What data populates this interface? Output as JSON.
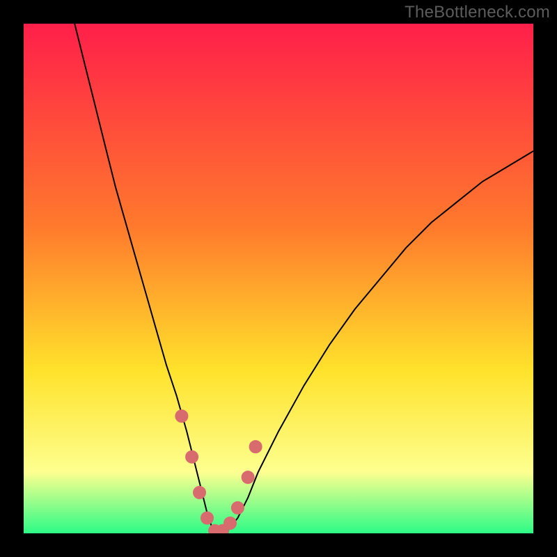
{
  "watermark": "TheBottleneck.com",
  "colors": {
    "frame": "#000000",
    "gradient_top": "#ff1f4a",
    "gradient_mid1": "#ff7a2c",
    "gradient_mid2": "#ffe22b",
    "gradient_mid3": "#fdff8f",
    "gradient_bottom": "#2cfb86",
    "marker_fill": "#d86b6e",
    "marker_stroke": "#d86b6e",
    "curve_stroke": "#000000"
  },
  "chart_data": {
    "type": "line",
    "title": "",
    "xlabel": "",
    "ylabel": "",
    "xlim": [
      0,
      100
    ],
    "ylim": [
      0,
      100
    ],
    "series": [
      {
        "name": "bottleneck-curve",
        "x": [
          10,
          12,
          14,
          16,
          18,
          20,
          22,
          24,
          26,
          28,
          30,
          32,
          34,
          35,
          36,
          37,
          38,
          39,
          40,
          42,
          44,
          46,
          50,
          55,
          60,
          65,
          70,
          75,
          80,
          85,
          90,
          95,
          100
        ],
        "y": [
          100,
          92,
          84,
          76,
          68,
          61,
          54,
          47,
          40,
          33,
          27,
          20,
          12,
          8,
          4,
          1,
          0,
          0,
          0.5,
          3,
          7,
          12,
          20,
          29,
          37,
          44,
          50,
          56,
          61,
          65,
          69,
          72,
          75
        ]
      }
    ],
    "markers": {
      "name": "highlight-points",
      "x": [
        31,
        33,
        34.5,
        36,
        37.5,
        39,
        40.5,
        42,
        44,
        45.5
      ],
      "y": [
        23,
        15,
        8,
        3,
        0.5,
        0.5,
        2,
        5,
        11,
        17
      ]
    }
  }
}
